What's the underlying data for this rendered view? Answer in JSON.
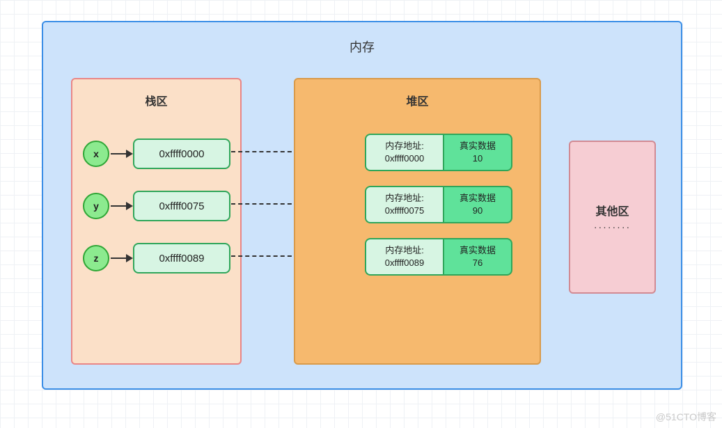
{
  "title": "内存",
  "stack": {
    "title": "栈区",
    "rows": [
      {
        "var": "x",
        "addr": "0xffff0000"
      },
      {
        "var": "y",
        "addr": "0xffff0075"
      },
      {
        "var": "z",
        "addr": "0xffff0089"
      }
    ]
  },
  "heap": {
    "title": "堆区",
    "addr_label": "内存地址:",
    "data_label": "真实数据",
    "rows": [
      {
        "addr": "0xffff0000",
        "value": "10"
      },
      {
        "addr": "0xffff0075",
        "value": "90"
      },
      {
        "addr": "0xffff0089",
        "value": "76"
      }
    ]
  },
  "other": {
    "title": "其他区",
    "dots": "········"
  },
  "watermark": "@51CTO博客",
  "chart_data": {
    "type": "table",
    "description": "Memory layout diagram: stack variables point to heap entries",
    "mapping": [
      {
        "variable": "x",
        "stack_pointer": "0xffff0000",
        "heap_address": "0xffff0000",
        "heap_value": 10
      },
      {
        "variable": "y",
        "stack_pointer": "0xffff0075",
        "heap_address": "0xffff0075",
        "heap_value": 90
      },
      {
        "variable": "z",
        "stack_pointer": "0xffff0089",
        "heap_address": "0xffff0089",
        "heap_value": 76
      }
    ],
    "regions": [
      "栈区",
      "堆区",
      "其他区"
    ]
  }
}
